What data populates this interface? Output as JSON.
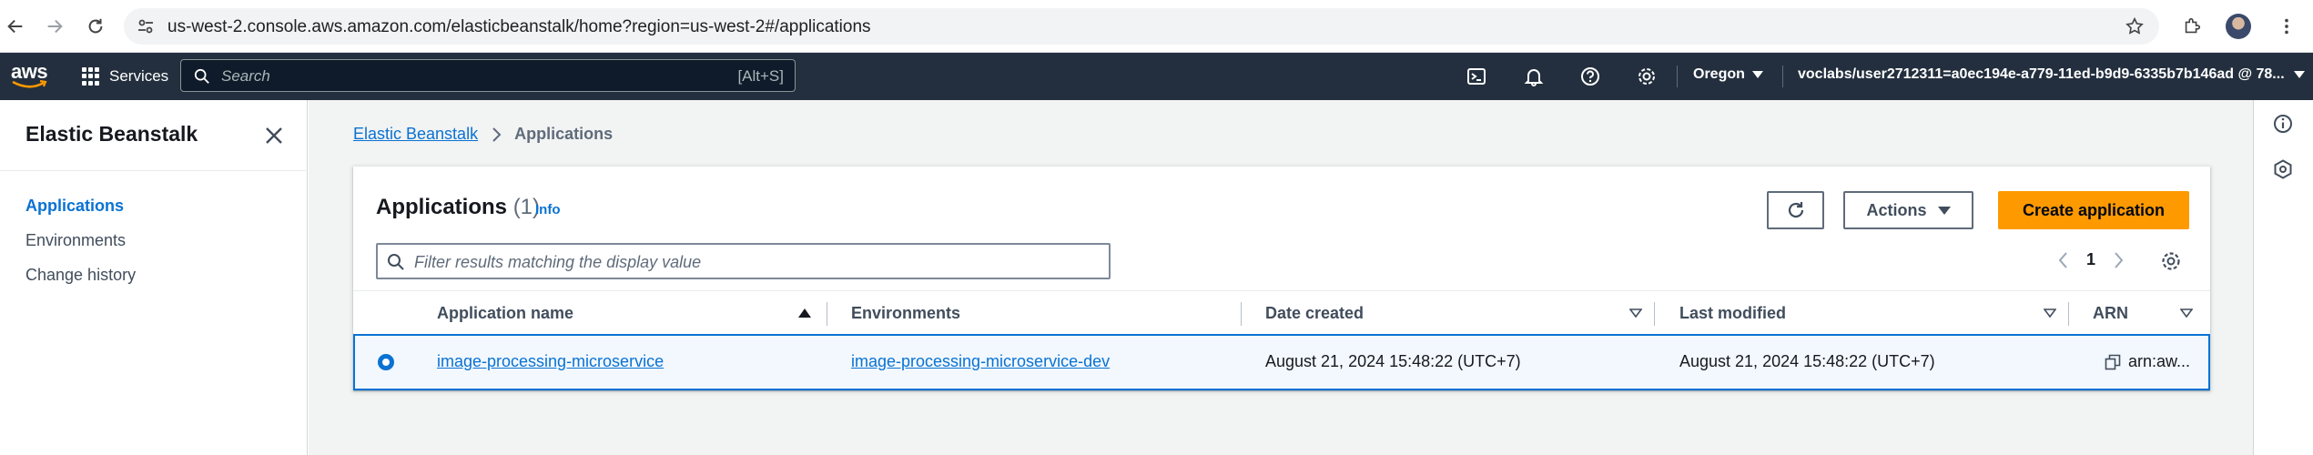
{
  "browser": {
    "url": "us-west-2.console.aws.amazon.com/elasticbeanstalk/home?region=us-west-2#/applications"
  },
  "aws_nav": {
    "logo_text": "aws",
    "services_label": "Services",
    "search_placeholder": "Search",
    "search_shortcut": "[Alt+S]",
    "region": "Oregon",
    "account": "voclabs/user2712311=a0ec194e-a779-11ed-b9d9-6335b7b146ad @ 78..."
  },
  "sidebar": {
    "title": "Elastic Beanstalk",
    "items": [
      {
        "label": "Applications",
        "active": true
      },
      {
        "label": "Environments",
        "active": false
      },
      {
        "label": "Change history",
        "active": false
      }
    ]
  },
  "breadcrumb": {
    "parent": "Elastic Beanstalk",
    "current": "Applications"
  },
  "applications": {
    "title": "Applications",
    "count": "(1)",
    "info_label": "Info",
    "actions_label": "Actions",
    "create_label": "Create application",
    "filter_placeholder": "Filter results matching the display value",
    "page_number": "1",
    "columns": [
      "Application name",
      "Environments",
      "Date created",
      "Last modified",
      "ARN"
    ],
    "rows": [
      {
        "selected": true,
        "name": "image-processing-microservice",
        "environments": "image-processing-microservice-dev",
        "date_created": "August 21, 2024 15:48:22 (UTC+7)",
        "last_modified": "August 21, 2024 15:48:22 (UTC+7)",
        "arn": "arn:aw..."
      }
    ]
  },
  "colors": {
    "aws_nav_bg": "#232f3e",
    "accent": "#0972d3",
    "primary_button": "#ff9900"
  }
}
